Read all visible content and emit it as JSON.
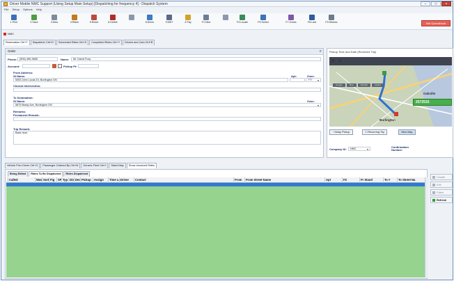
{
  "window": {
    "title": "Driver Mobile NMC Support (Using Setup Main Setup) [Dispatching for frequency 4] - Dispatch System",
    "minimize_label": "–",
    "maximize_label": "□",
    "close_label": "×"
  },
  "menu": [
    "File",
    "Setup",
    "Options",
    "Help"
  ],
  "toolbar": [
    {
      "label": "1.Print",
      "color": "#3d6fb5"
    },
    {
      "label": "2.Save",
      "color": "#4f9d44"
    },
    {
      "label": "3.New",
      "color": "#7e8aa0"
    },
    {
      "label": "4.Rides",
      "color": "#c47a1e"
    },
    {
      "label": "5.Reset",
      "color": "#b94a3f"
    },
    {
      "label": "6.Delete",
      "color": "#b02c2c"
    },
    {
      "label": "",
      "color": "#8d99ab"
    },
    {
      "label": "8.Driver",
      "color": "#3b7cc4"
    },
    {
      "label": "9.MDT",
      "color": "#5a6a85"
    },
    {
      "label": "Z.Pay",
      "color": "#d4a12b"
    },
    {
      "label": "F1.New",
      "color": "#6d7d98"
    },
    {
      "label": "",
      "color": "#8d99ab"
    },
    {
      "label": "F3.Locate",
      "color": "#3d8a5a"
    },
    {
      "label": "F5.Sched",
      "color": "#3c73b8"
    },
    {
      "label": "F7.Zones",
      "color": "#7b5aa6"
    },
    {
      "label": "F8.Last",
      "color": "#2f5d9b"
    },
    {
      "label": "F9.Historic",
      "color": "#6e7a8e"
    }
  ],
  "status_button": "Not Operational",
  "mode_indicator": "NMC",
  "top_tabs": [
    "Reservation Ctrl+T",
    "Dispatcher Ctrl+D",
    "Scheduled Rides Ctrl+S",
    "Completed Rides Ctrl+Y",
    "Drivers and Cars Ctrl+B"
  ],
  "order": {
    "header": "Order",
    "phone_label": "Phone:",
    "phone_value": "(905) 455-3665",
    "name_label": "Name:",
    "name_value": "Mr. David Foxy",
    "account_label": "Account:",
    "pickup_label": "Pickup Pt:",
    "from_address_label": "From Address:",
    "st_name_label": "St Name:",
    "from_street": "5353 John Lucas Dr, Burlington ON",
    "apt_label": "Apt:",
    "zone_label": "Zone:",
    "from_zone": "???",
    "closest_intersection_label": "Closest Intersection:",
    "to_destination_label": "To Destination:",
    "to_st_name_label": "St Name:",
    "to_street": "5875 Brady Ave, Burlington ON",
    "to_zone_label": "Zone:",
    "remarks_label": "Remarks:",
    "permanent_remark_label": "Permanent Remark:",
    "trip_remark_label": "Trip Remark:",
    "trip_remark": "Back door."
  },
  "map": {
    "header": "Pickup Time and Date (Received Trip)",
    "tabs": [
      "Google",
      "Map",
      "Satellite",
      "Hybrid"
    ],
    "place_labels": [
      "Oakville",
      "Burlington"
    ],
    "delay_pickup": "Delay Pickup",
    "recurring_trip": "Recurring Trip",
    "view_map": "View Map",
    "company_label": "Company ID:",
    "company_value": "NMC",
    "confirmation_label": "Confirmation Number:",
    "confirmation_number": "2572515"
  },
  "lower_tabs": [
    "Vehicle Prev Driver Ctrl+G",
    "Passenger Ordered By Ctrl+M",
    "Generic Fleet Ctrl+I",
    "Stand Map",
    "Show Unsolved Rides"
  ],
  "sub_tabs": [
    "Being Edited",
    "Rides To Be Dispatched",
    "Rides Dispatched"
  ],
  "grid_columns": [
    "Called",
    "Was",
    "Sort",
    "Fig",
    "SF",
    "Typ",
    "Dis",
    "Ded",
    "Pickup",
    "Assign",
    "Time Lc",
    "Driver",
    "Contact",
    "From",
    "From Street Name",
    "Apt",
    "FZ",
    "Fr Stand",
    "To #",
    "To Street Na"
  ],
  "side_buttons": [
    "Unsafe",
    "Edit",
    "Fdata",
    "Refresh"
  ]
}
